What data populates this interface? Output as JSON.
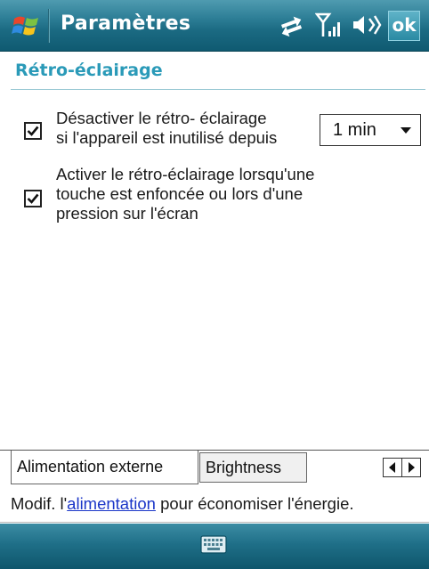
{
  "titlebar": {
    "title": "Paramètres",
    "ok_label": "ok",
    "icons": [
      "windows-start-icon",
      "connectivity-icon",
      "signal-icon",
      "volume-icon"
    ]
  },
  "section": {
    "title": "Rétro-éclairage"
  },
  "options": {
    "disable_backlight": {
      "checked": true,
      "line1": "Désactiver le rétro- éclairage",
      "line2": "si l'appareil est inutilisé depuis"
    },
    "timeout_select": {
      "value": "1 min"
    },
    "enable_on_touch": {
      "checked": true,
      "line1": "Activer le rétro-éclairage lorsqu'une",
      "line2": "touche est enfoncée ou lors d'une",
      "line3": "pression sur l'écran"
    }
  },
  "tabs": [
    {
      "label": "Alimentation externe",
      "active": true
    },
    {
      "label": "Brightness",
      "active": false
    }
  ],
  "hint": {
    "prefix": "Modif. l'",
    "link": "alimentation",
    "suffix": " pour économiser l'énergie."
  },
  "bottombar": {
    "icon": "keyboard-icon"
  },
  "colors": {
    "titlebar": "#1b6a82",
    "section_title": "#2a9ab8",
    "link": "#1b36c8"
  }
}
